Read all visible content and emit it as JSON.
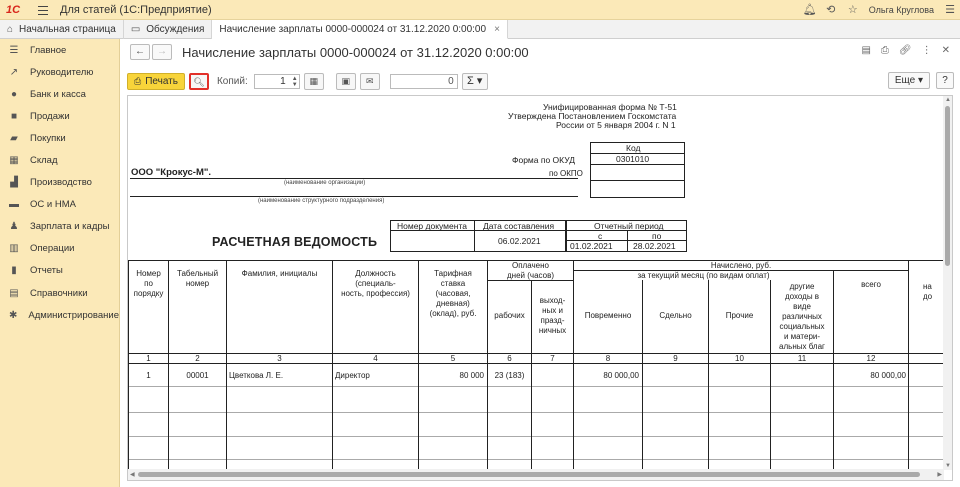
{
  "titlebar": {
    "logo": "1С",
    "title": "Для статей  (1С:Предприятие)",
    "user": "Ольга Круглова"
  },
  "tabs": [
    {
      "label": "Начальная страница",
      "icon": "home-icon"
    },
    {
      "label": "Обсуждения",
      "icon": "chat-icon"
    },
    {
      "label": "Начисление зарплаты 0000-000024 от 31.12.2020 0:00:00",
      "icon": "",
      "active": true,
      "close": "×"
    }
  ],
  "sidebar": {
    "items": [
      {
        "label": "Главное",
        "icon": "menu-icon",
        "glyph": "☰"
      },
      {
        "label": "Руководителю",
        "icon": "trend-icon",
        "glyph": "↗"
      },
      {
        "label": "Банк и касса",
        "icon": "coin-icon",
        "glyph": "●"
      },
      {
        "label": "Продажи",
        "icon": "bag-icon",
        "glyph": "■"
      },
      {
        "label": "Покупки",
        "icon": "cart-icon",
        "glyph": "▰"
      },
      {
        "label": "Склад",
        "icon": "warehouse-icon",
        "glyph": "▦"
      },
      {
        "label": "Производство",
        "icon": "factory-icon",
        "glyph": "▟"
      },
      {
        "label": "ОС и НМА",
        "icon": "assets-icon",
        "glyph": "▬"
      },
      {
        "label": "Зарплата и кадры",
        "icon": "people-icon",
        "glyph": "♟"
      },
      {
        "label": "Операции",
        "icon": "operations-icon",
        "glyph": "▥"
      },
      {
        "label": "Отчеты",
        "icon": "reports-icon",
        "glyph": "▮"
      },
      {
        "label": "Справочники",
        "icon": "book-icon",
        "glyph": "▤"
      },
      {
        "label": "Администрирование",
        "icon": "gear-icon",
        "glyph": "✱"
      }
    ]
  },
  "header": {
    "title": "Начисление зарплаты 0000-000024 от 31.12.2020 0:00:00"
  },
  "toolbar": {
    "print_label": "Печать",
    "copies_label": "Копий:",
    "copies_value": "1",
    "sum_value": "0",
    "sigma": "Σ",
    "more_label": "Еще",
    "help_label": "?"
  },
  "doc": {
    "form_line1": "Унифицированная форма № Т-51",
    "form_line2": "Утверждена Постановлением Госкомстата",
    "form_line3": "России от 5 января 2004 г. N 1",
    "kod": "Код",
    "okud_label": "Форма по ОКУД",
    "okud_value": "0301010",
    "okpo_label": "по ОКПО",
    "org_name": "ООО \"Крокус-М\".",
    "org_caption": "(наименование организации)",
    "dept_caption": "(наименование структурного подразделения)",
    "doc_number_label": "Номер документа",
    "doc_date_label": "Дата составления",
    "doc_date": "06.02.2021",
    "period_label": "Отчетный период",
    "period_from_label": "с",
    "period_to_label": "по",
    "period_from": "01.02.2021",
    "period_to": "28.02.2021",
    "heading": "РАСЧЕТНАЯ ВЕДОМОСТЬ",
    "col1": "Номер\nпо\nпорядку",
    "col2": "Табельный\nномер",
    "col3": "Фамилия, инициалы",
    "col4": "Должность\n(специаль-\nность, профессия)",
    "col5": "Тарифная\nставка\n(часовая,\nдневная)\n(оклад), руб.",
    "col6_group": "Оплачено\nдней (часов)",
    "col6": "рабочих",
    "col7": "выход-\nных и\nпразд-\nничных",
    "accrued_group": "Начислено, руб.",
    "current_month": "за текущий месяц  (по видам оплат)",
    "col8": "Повременно",
    "col9": "Сдельно",
    "col10": "Прочие",
    "col11": "другие\nдоходы в\nвиде\nразличных\nсоциальных\nи матери-\nальных благ",
    "col12": "всего",
    "col13_cut": "на\nдо",
    "numbers": [
      "1",
      "2",
      "3",
      "4",
      "5",
      "6",
      "7",
      "8",
      "9",
      "10",
      "11",
      "12"
    ],
    "row": {
      "n": "1",
      "tab": "00001",
      "name": "Цветкова Л. Е.",
      "position": "Директор",
      "rate": "80 000",
      "days": "23 (183)",
      "time_pay": "80 000,00",
      "total": "80 000,00"
    }
  }
}
